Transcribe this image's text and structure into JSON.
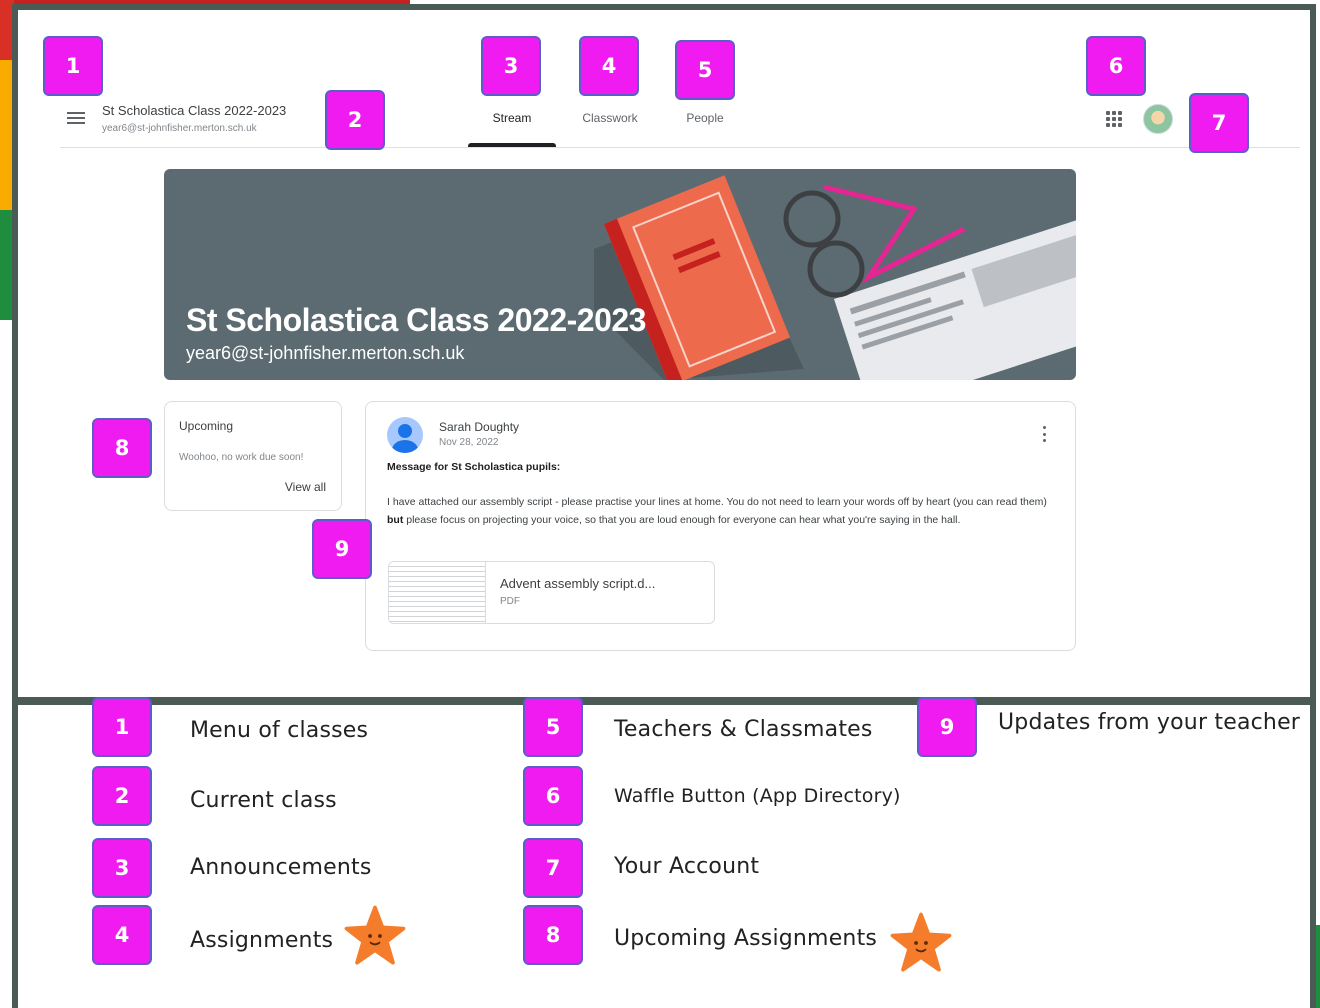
{
  "header": {
    "class_title": "St Scholastica Class 2022-2023",
    "class_email": "year6@st-johnfisher.merton.sch.uk",
    "tabs": [
      {
        "label": "Stream"
      },
      {
        "label": "Classwork"
      },
      {
        "label": "People"
      }
    ],
    "active_tab": "Stream",
    "icons": [
      "menu-icon",
      "apps-grid-icon",
      "account-avatar"
    ]
  },
  "banner": {
    "title": "St Scholastica Class 2022-2023",
    "email": "year6@st-johnfisher.merton.sch.uk"
  },
  "upcoming": {
    "title": "Upcoming",
    "message": "Woohoo, no work due soon!",
    "link": "View all"
  },
  "post": {
    "author": "Sarah Doughty",
    "date": "Nov 28, 2022",
    "heading": "Message for St Scholastica pupils:",
    "body_part1": "I have attached our assembly script - please practise your lines at home. You do not need to learn your words off by heart (you can read them) ",
    "body_bold": "but",
    "body_part2": " please focus on projecting your voice, so that you are loud enough for everyone can hear what you're saying in the hall.",
    "attachment": {
      "name": "Advent assembly script.d...",
      "type": "PDF"
    }
  },
  "badges": [
    "1",
    "2",
    "3",
    "4",
    "5",
    "6",
    "7",
    "8",
    "9"
  ],
  "legend": [
    {
      "num": "1",
      "label": "Menu of classes"
    },
    {
      "num": "2",
      "label": "Current class"
    },
    {
      "num": "3",
      "label": "Announcements"
    },
    {
      "num": "4",
      "label": "Assignments"
    },
    {
      "num": "5",
      "label": "Teachers & Classmates"
    },
    {
      "num": "6",
      "label": "Waffle Button (App Directory)"
    },
    {
      "num": "7",
      "label": "Your Account"
    },
    {
      "num": "8",
      "label": "Upcoming Assignments"
    },
    {
      "num": "9",
      "label": "Updates from your teacher"
    }
  ],
  "colors": {
    "badge": "#f01bf0",
    "frame": "#4a5a54",
    "banner": "#5b6b71",
    "star": "#f47c2a"
  }
}
